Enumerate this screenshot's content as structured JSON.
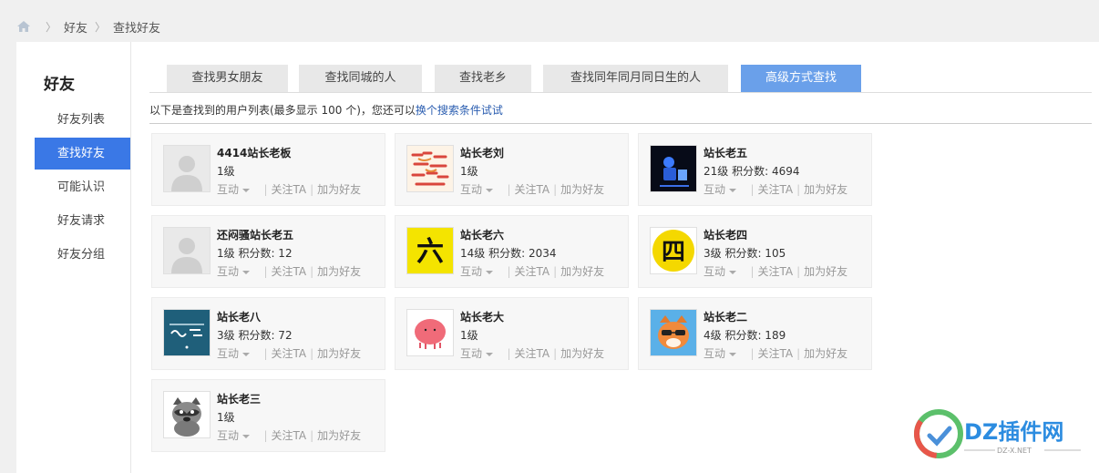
{
  "breadcrumb": {
    "items": [
      "好友",
      "查找好友"
    ]
  },
  "sidebar": {
    "title": "好友",
    "items": [
      {
        "label": "好友列表"
      },
      {
        "label": "查找好友",
        "active": true
      },
      {
        "label": "可能认识"
      },
      {
        "label": "好友请求"
      },
      {
        "label": "好友分组"
      }
    ]
  },
  "tabs": [
    {
      "label": "查找男女朋友"
    },
    {
      "label": "查找同城的人"
    },
    {
      "label": "查找老乡"
    },
    {
      "label": "查找同年同月同日生的人"
    },
    {
      "label": "高级方式查找",
      "active": true
    }
  ],
  "info": {
    "text": "以下是查找到的用户列表(最多显示 100 个)，您还可以",
    "link": "换个搜索条件试试"
  },
  "actions": {
    "interact": "互动",
    "follow": "关注TA",
    "add": "加为好友"
  },
  "users": [
    {
      "name": "4414站长老板",
      "level": "1级",
      "avatar": "default-avatar"
    },
    {
      "name": "站长老刘",
      "level": "1级",
      "avatar": "text-art-avatar"
    },
    {
      "name": "站长老五",
      "level": "21级  积分数: 4694",
      "avatar": "robot-avatar"
    },
    {
      "name": "还闷骚站长老五",
      "level": "1级  积分数: 12",
      "avatar": "default-avatar"
    },
    {
      "name": "站长老六",
      "level": "14级  积分数: 2034",
      "avatar": "six-char-avatar"
    },
    {
      "name": "站长老四",
      "level": "3级  积分数: 105",
      "avatar": "four-char-avatar"
    },
    {
      "name": "站长老八",
      "level": "3级  积分数: 72",
      "avatar": "sign-avatar"
    },
    {
      "name": "站长老大",
      "level": "1级",
      "avatar": "pink-blob-avatar"
    },
    {
      "name": "站长老二",
      "level": "4级  积分数: 189",
      "avatar": "raccoon-sunglasses-avatar"
    },
    {
      "name": "站长老三",
      "level": "1级",
      "avatar": "raccoon-avatar"
    }
  ],
  "avatar_chars": {
    "six": "六",
    "four": "四"
  },
  "watermark": {
    "brand": "DZ插件网",
    "url": "DZ-X.NET"
  },
  "colors": {
    "accent": "#3a78e6",
    "tab_active": "#6aa0ea",
    "link": "#2a5db0"
  }
}
